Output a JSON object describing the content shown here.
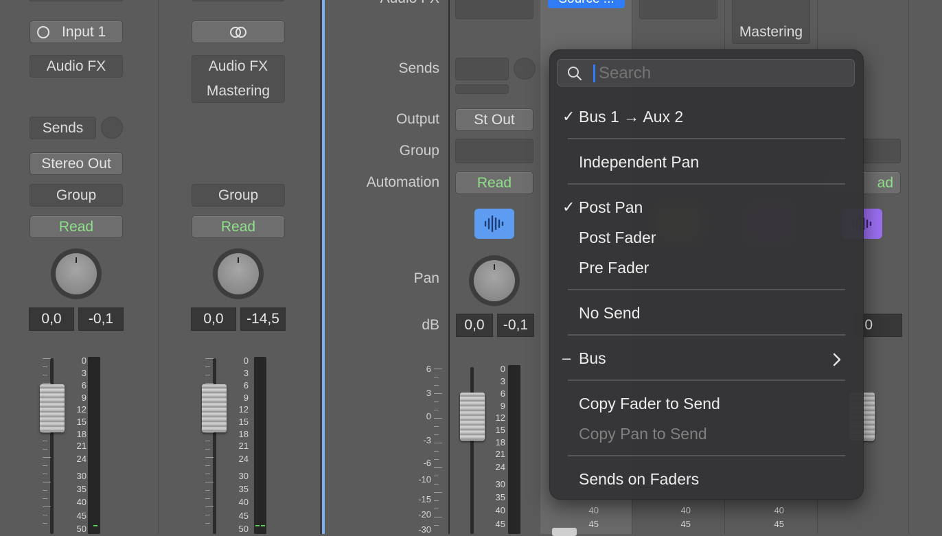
{
  "strips": {
    "s1": {
      "input": "Input 1",
      "audio_fx": "Audio FX",
      "sends": "Sends",
      "output": "Stereo Out",
      "group": "Group",
      "automation": "Read",
      "volume": "0,0",
      "peak": "-0,1"
    },
    "s2": {
      "audio_fx": "Audio FX",
      "plugin": "Mastering",
      "group": "Group",
      "automation": "Read",
      "volume": "0,0",
      "peak": "-14,5"
    },
    "s3": {
      "output": "St Out",
      "automation": "Read",
      "volume": "0,0",
      "peak": "-0,1"
    },
    "s4": {
      "send": "Source ..."
    },
    "s6": {
      "plugin": "Mastering"
    },
    "s7": {
      "automation": "ad",
      "volume": "0"
    }
  },
  "inspector_labels": {
    "audio_fx": "Audio FX",
    "sends": "Sends",
    "output": "Output",
    "group": "Group",
    "automation": "Automation",
    "pan": "Pan",
    "db": "dB"
  },
  "fader_scale_a": [
    "0",
    "3",
    "6",
    "9",
    "12",
    "15",
    "18",
    "21",
    "24",
    "30",
    "35",
    "40",
    "45",
    "50"
  ],
  "fader_scale_b": [
    "6",
    "3",
    "0",
    "-3",
    "-6",
    "-10",
    "-15",
    "-20",
    "-30"
  ],
  "fader_scale_c": [
    "0",
    "3",
    "6",
    "9",
    "12",
    "15",
    "18",
    "21",
    "24",
    "30",
    "35",
    "40",
    "45"
  ],
  "fader_scale_d": [
    "40",
    "45"
  ],
  "menu": {
    "search_placeholder": "Search",
    "check_mark": "✓",
    "dash_mark": "–",
    "items": {
      "bus_route": "Bus 1 → Aux 2",
      "independent_pan": "Independent Pan",
      "post_pan": "Post Pan",
      "post_fader": "Post Fader",
      "pre_fader": "Pre Fader",
      "no_send": "No Send",
      "bus": "Bus",
      "copy_fader": "Copy Fader to Send",
      "copy_pan": "Copy Pan to Send",
      "sends_on_faders": "Sends on Faders"
    }
  },
  "colors": {
    "accent_blue": "#2f7cf6",
    "read_green": "#8fe08a",
    "peak_yellow": "#f0c54a",
    "audio_icon_blue": "#5e9cf2",
    "audio_icon_purple": "#9b6ff2"
  }
}
